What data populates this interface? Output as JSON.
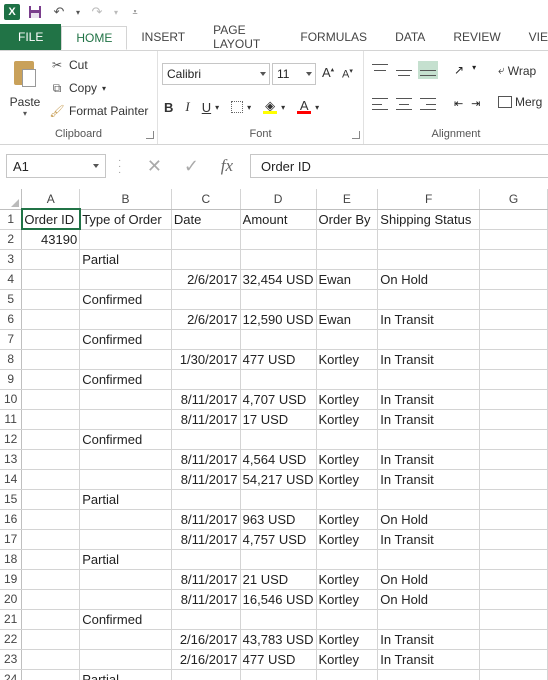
{
  "ribbon": {
    "tabs": [
      "FILE",
      "HOME",
      "INSERT",
      "PAGE LAYOUT",
      "FORMULAS",
      "DATA",
      "REVIEW",
      "VIE"
    ],
    "active_tab": "HOME",
    "clipboard": {
      "paste": "Paste",
      "cut": "Cut",
      "copy": "Copy",
      "format_painter": "Format Painter",
      "group_label": "Clipboard"
    },
    "font": {
      "font_name": "Calibri",
      "font_size": "11",
      "bold": "B",
      "italic": "I",
      "underline": "U",
      "group_label": "Font"
    },
    "alignment": {
      "wrap": "Wrap",
      "merge": "Merg",
      "group_label": "Alignment"
    }
  },
  "formula_bar": {
    "name_box": "A1",
    "fx": "fx",
    "content": "Order ID"
  },
  "grid": {
    "columns": [
      "A",
      "B",
      "C",
      "D",
      "E",
      "F",
      "G"
    ],
    "rows": [
      {
        "n": "1",
        "cells": [
          "Order ID",
          "Type of Order",
          "Date",
          "Amount",
          "Order By",
          "Shipping Status",
          ""
        ]
      },
      {
        "n": "2",
        "cells": [
          "43190",
          "",
          "",
          "",
          "",
          "",
          ""
        ]
      },
      {
        "n": "3",
        "cells": [
          "",
          "Partial",
          "",
          "",
          "",
          "",
          ""
        ]
      },
      {
        "n": "4",
        "cells": [
          "",
          "",
          "2/6/2017",
          "32,454 USD",
          "Ewan",
          "On Hold",
          ""
        ]
      },
      {
        "n": "5",
        "cells": [
          "",
          "Confirmed",
          "",
          "",
          "",
          "",
          ""
        ]
      },
      {
        "n": "6",
        "cells": [
          "",
          "",
          "2/6/2017",
          "12,590 USD",
          "Ewan",
          "In Transit",
          ""
        ]
      },
      {
        "n": "7",
        "cells": [
          "",
          "Confirmed",
          "",
          "",
          "",
          "",
          ""
        ]
      },
      {
        "n": "8",
        "cells": [
          "",
          "",
          "1/30/2017",
          "477 USD",
          "Kortley",
          "In Transit",
          ""
        ]
      },
      {
        "n": "9",
        "cells": [
          "",
          "Confirmed",
          "",
          "",
          "",
          "",
          ""
        ]
      },
      {
        "n": "10",
        "cells": [
          "",
          "",
          "8/11/2017",
          "4,707 USD",
          "Kortley",
          "In Transit",
          ""
        ]
      },
      {
        "n": "11",
        "cells": [
          "",
          "",
          "8/11/2017",
          "17 USD",
          "Kortley",
          "In Transit",
          ""
        ]
      },
      {
        "n": "12",
        "cells": [
          "",
          "Confirmed",
          "",
          "",
          "",
          "",
          ""
        ]
      },
      {
        "n": "13",
        "cells": [
          "",
          "",
          "8/11/2017",
          "4,564 USD",
          "Kortley",
          "In Transit",
          ""
        ]
      },
      {
        "n": "14",
        "cells": [
          "",
          "",
          "8/11/2017",
          "54,217 USD",
          "Kortley",
          "In Transit",
          ""
        ]
      },
      {
        "n": "15",
        "cells": [
          "",
          "Partial",
          "",
          "",
          "",
          "",
          ""
        ]
      },
      {
        "n": "16",
        "cells": [
          "",
          "",
          "8/11/2017",
          "963 USD",
          "Kortley",
          "On Hold",
          ""
        ]
      },
      {
        "n": "17",
        "cells": [
          "",
          "",
          "8/11/2017",
          "4,757 USD",
          "Kortley",
          "In Transit",
          ""
        ]
      },
      {
        "n": "18",
        "cells": [
          "",
          "Partial",
          "",
          "",
          "",
          "",
          ""
        ]
      },
      {
        "n": "19",
        "cells": [
          "",
          "",
          "8/11/2017",
          "21 USD",
          "Kortley",
          "On Hold",
          ""
        ]
      },
      {
        "n": "20",
        "cells": [
          "",
          "",
          "8/11/2017",
          "16,546 USD",
          "Kortley",
          "On Hold",
          ""
        ]
      },
      {
        "n": "21",
        "cells": [
          "",
          "Confirmed",
          "",
          "",
          "",
          "",
          ""
        ]
      },
      {
        "n": "22",
        "cells": [
          "",
          "",
          "2/16/2017",
          "43,783 USD",
          "Kortley",
          "In Transit",
          ""
        ]
      },
      {
        "n": "23",
        "cells": [
          "",
          "",
          "2/16/2017",
          "477 USD",
          "Kortley",
          "In Transit",
          ""
        ]
      },
      {
        "n": "24",
        "cells": [
          "",
          "Partial",
          "",
          "",
          "",
          "",
          ""
        ]
      }
    ],
    "right_aligned_columns": [
      0,
      2
    ]
  },
  "colors": {
    "accent": "#217346"
  }
}
